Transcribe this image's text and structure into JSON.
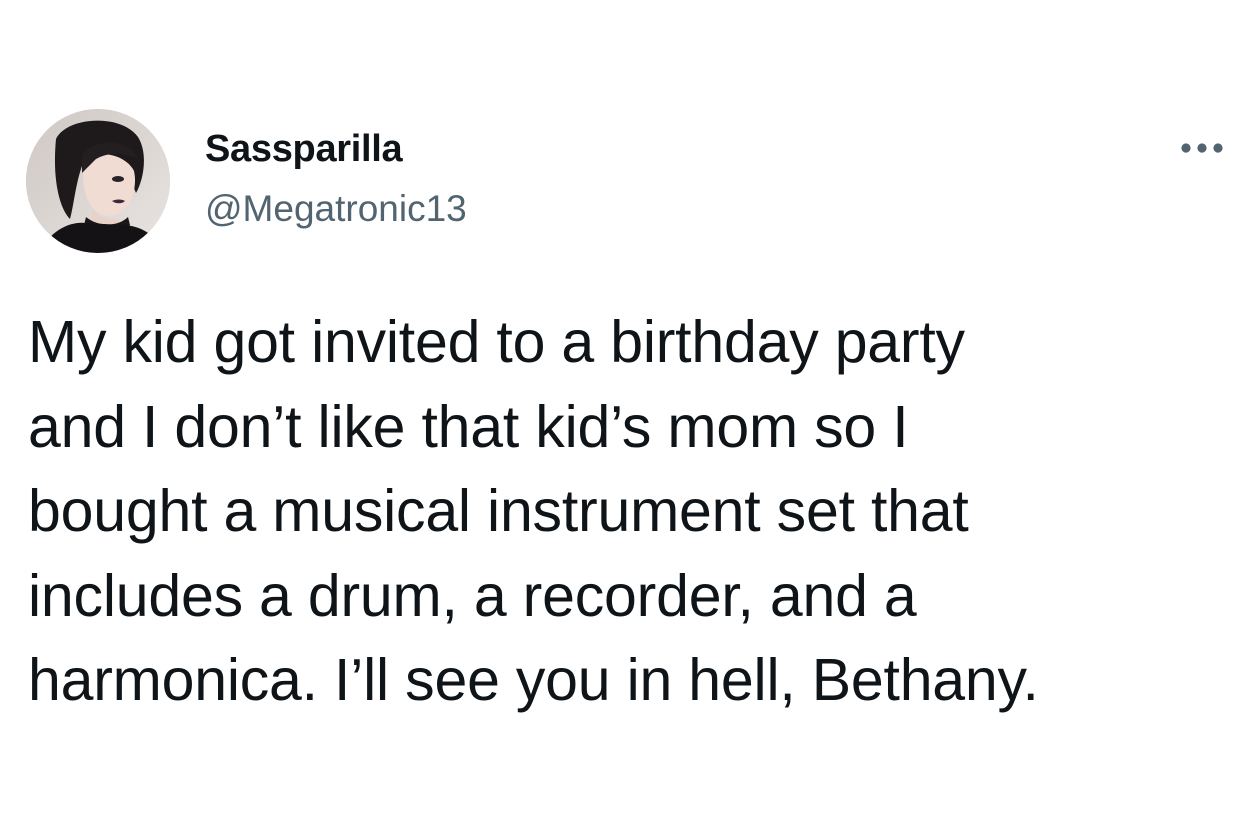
{
  "author": {
    "display_name": "Sassparilla",
    "handle": "@Megatronic13"
  },
  "tweet": {
    "lines": [
      "My kid got invited to a birthday party",
      "and I don’t like that kid’s mom so I",
      "bought a musical instrument set that",
      "includes a drum, a recorder, and a",
      "harmonica. I’ll see you in hell, Bethany."
    ]
  },
  "icons": {
    "more": "more-horizontal-icon",
    "avatar": "avatar-photo"
  },
  "colors": {
    "text_primary": "#0f1419",
    "text_secondary": "#536471",
    "background": "#ffffff"
  }
}
